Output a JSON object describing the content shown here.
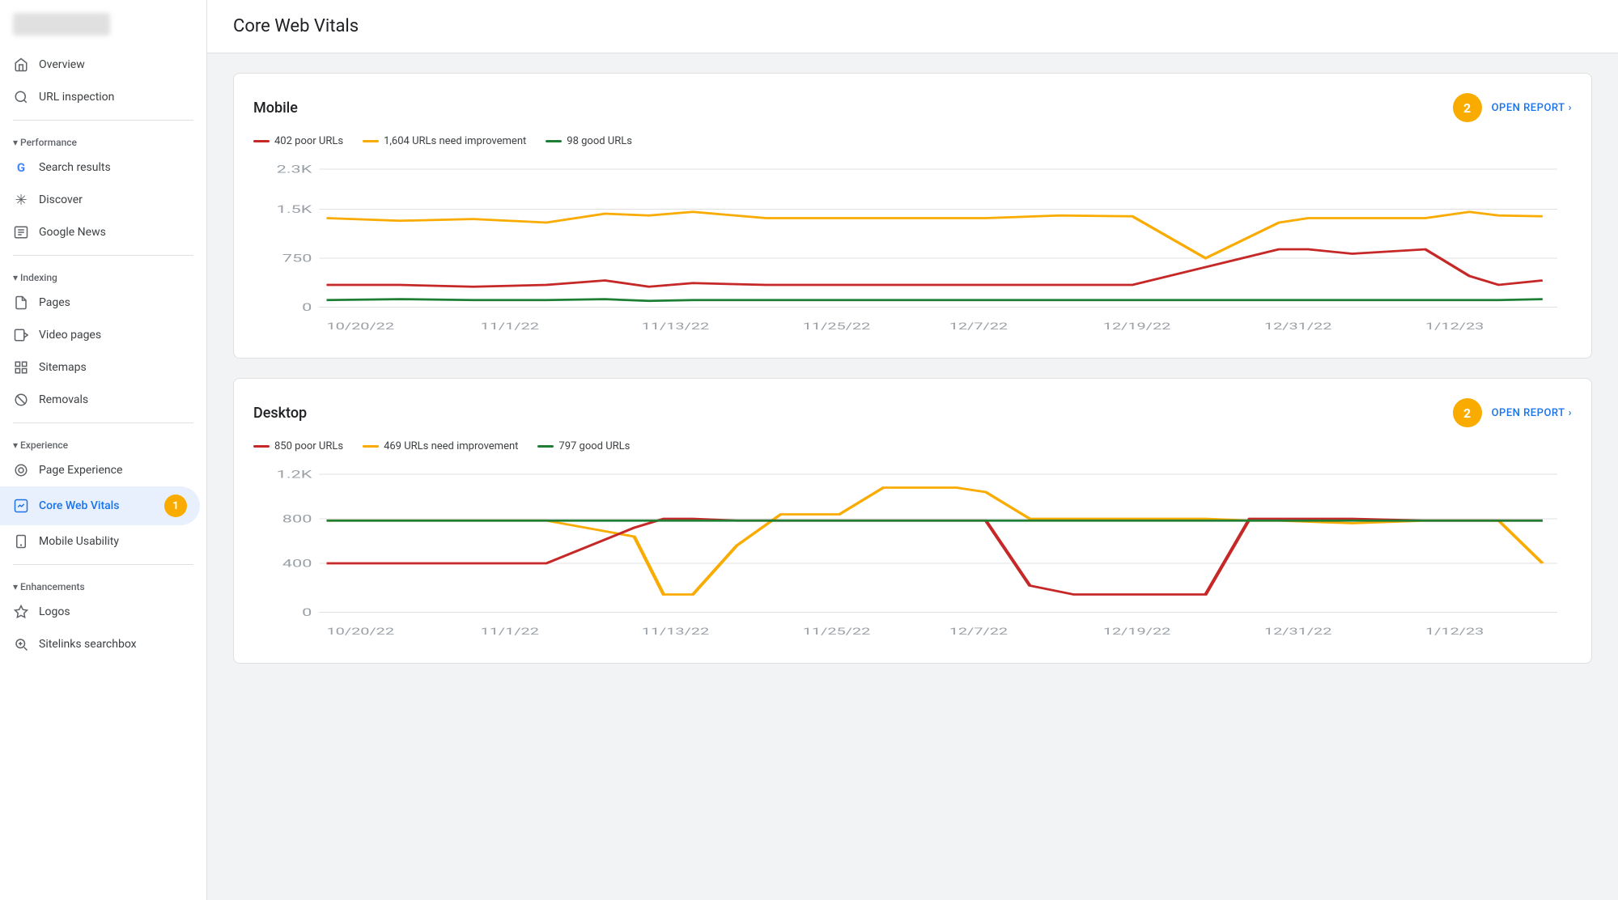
{
  "app": {
    "title": "Core Web Vitals"
  },
  "sidebar": {
    "logo_alt": "Google Search Console logo",
    "sections": [
      {
        "items": [
          {
            "id": "overview",
            "label": "Overview",
            "icon": "home"
          },
          {
            "id": "url-inspection",
            "label": "URL inspection",
            "icon": "search"
          }
        ]
      },
      {
        "label": "Performance",
        "items": [
          {
            "id": "search-results",
            "label": "Search results",
            "icon": "g"
          },
          {
            "id": "discover",
            "label": "Discover",
            "icon": "asterisk"
          },
          {
            "id": "google-news",
            "label": "Google News",
            "icon": "news"
          }
        ]
      },
      {
        "label": "Indexing",
        "items": [
          {
            "id": "pages",
            "label": "Pages",
            "icon": "pages"
          },
          {
            "id": "video-pages",
            "label": "Video pages",
            "icon": "video"
          },
          {
            "id": "sitemaps",
            "label": "Sitemaps",
            "icon": "sitemaps"
          },
          {
            "id": "removals",
            "label": "Removals",
            "icon": "removals"
          }
        ]
      },
      {
        "label": "Experience",
        "items": [
          {
            "id": "page-experience",
            "label": "Page Experience",
            "icon": "experience"
          },
          {
            "id": "core-web-vitals",
            "label": "Core Web Vitals",
            "icon": "cwv",
            "active": true
          },
          {
            "id": "mobile-usability",
            "label": "Mobile Usability",
            "icon": "mobile"
          }
        ]
      },
      {
        "label": "Enhancements",
        "items": [
          {
            "id": "logos",
            "label": "Logos",
            "icon": "logos"
          },
          {
            "id": "sitelinks-searchbox",
            "label": "Sitelinks searchbox",
            "icon": "sitelinks"
          }
        ]
      }
    ]
  },
  "mobile_card": {
    "title": "Mobile",
    "badge": "2",
    "open_report_label": "OPEN REPORT",
    "legend": [
      {
        "id": "poor",
        "label": "402 poor URLs",
        "color": "#c62828"
      },
      {
        "id": "improvement",
        "label": "1,604 URLs need improvement",
        "color": "#f9ab00"
      },
      {
        "id": "good",
        "label": "98 good URLs",
        "color": "#1e7e34"
      }
    ],
    "y_axis": [
      "2.3K",
      "1.5K",
      "750",
      "0"
    ],
    "x_axis": [
      "10/20/22",
      "11/1/22",
      "11/13/22",
      "11/25/22",
      "12/7/22",
      "12/19/22",
      "12/31/22",
      "1/12/23"
    ]
  },
  "desktop_card": {
    "title": "Desktop",
    "badge": "2",
    "open_report_label": "OPEN REPORT",
    "legend": [
      {
        "id": "poor",
        "label": "850 poor URLs",
        "color": "#c62828"
      },
      {
        "id": "improvement",
        "label": "469 URLs need improvement",
        "color": "#f9ab00"
      },
      {
        "id": "good",
        "label": "797 good URLs",
        "color": "#1e7e34"
      }
    ],
    "y_axis": [
      "1.2K",
      "800",
      "400",
      "0"
    ],
    "x_axis": [
      "10/20/22",
      "11/1/22",
      "11/13/22",
      "11/25/22",
      "12/7/22",
      "12/19/22",
      "12/31/22",
      "1/12/23"
    ]
  }
}
